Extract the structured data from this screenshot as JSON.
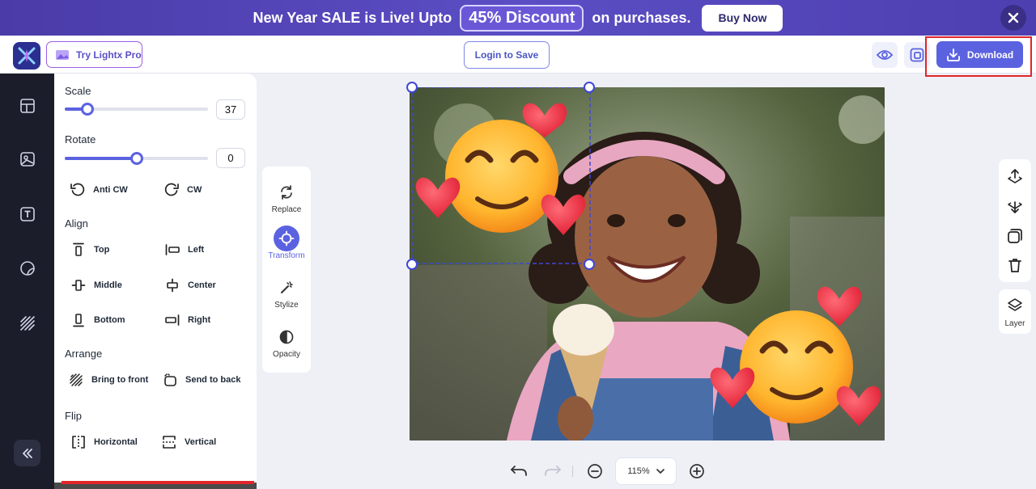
{
  "banner": {
    "text_before": "New Year SALE is Live! Upto",
    "discount": "45% Discount",
    "text_after": "on purchases.",
    "buy_label": "Buy Now"
  },
  "topbar": {
    "pro_label": "Try Lightx Pro",
    "login_label": "Login to Save",
    "download_label": "Download"
  },
  "leftbar": {
    "icons": [
      "templates-icon",
      "image-icon",
      "text-icon",
      "sticker-icon",
      "pattern-icon"
    ]
  },
  "panel": {
    "scale": {
      "label": "Scale",
      "value": "37",
      "level": 0.16
    },
    "rotate": {
      "label": "Rotate",
      "value": "0",
      "level": 0.5
    },
    "rotate_ccw": "Anti CW",
    "rotate_cw": "CW",
    "align": {
      "label": "Align",
      "top": "Top",
      "left": "Left",
      "middle": "Middle",
      "center": "Center",
      "bottom": "Bottom",
      "right": "Right"
    },
    "arrange": {
      "label": "Arrange",
      "front": "Bring to front",
      "back": "Send to back"
    },
    "flip": {
      "label": "Flip",
      "horizontal": "Horizontal",
      "vertical": "Vertical"
    }
  },
  "tools": {
    "replace": "Replace",
    "transform": "Transform",
    "stylize": "Stylize",
    "opacity": "Opacity"
  },
  "rightbar": {
    "layer": "Layer"
  },
  "bottom": {
    "zoom": "115%"
  },
  "colors": {
    "accent": "#5b62e0",
    "banner": "#4a3ba8",
    "highlight": "#e0262b"
  }
}
